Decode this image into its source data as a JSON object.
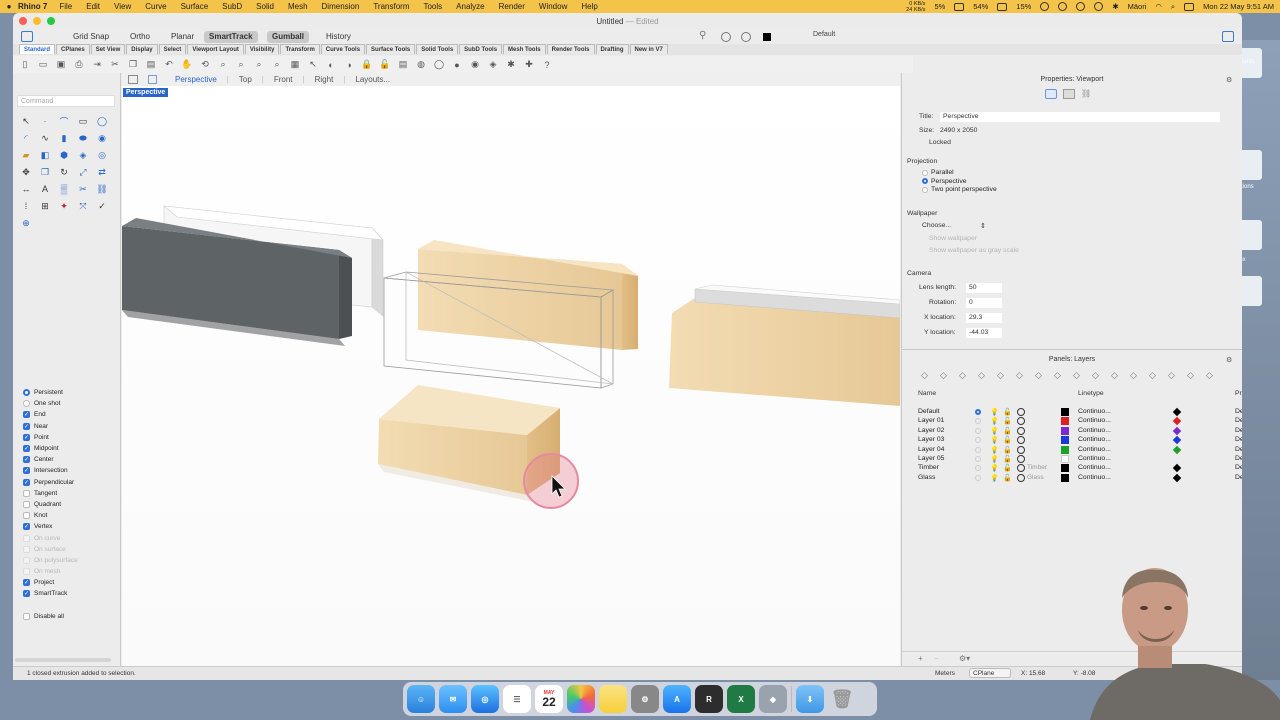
{
  "menubar": {
    "app_name": "Rhino 7",
    "items": [
      "File",
      "Edit",
      "View",
      "Curve",
      "Surface",
      "SubD",
      "Solid",
      "Mesh",
      "Dimension",
      "Transform",
      "Tools",
      "Analyze",
      "Render",
      "Window",
      "Help"
    ],
    "net_up": "0 KB/s",
    "net_down": "24 KB/s",
    "stat1": "5%",
    "stat2": "54%",
    "stat3": "15%",
    "user": "Māori",
    "clock": "Mon 22 May  9:51 AM"
  },
  "window": {
    "title": "Untitled",
    "edited": "— Edited"
  },
  "topbar": {
    "osnap_buttons": [
      "Grid Snap",
      "Ortho",
      "Planar",
      "SmartTrack",
      "Gumball",
      "History"
    ],
    "active_buttons": [
      "SmartTrack",
      "Gumball"
    ],
    "current_layer": "Default"
  },
  "tool_tabs": [
    "Standard",
    "CPlanes",
    "Set View",
    "Display",
    "Select",
    "Viewport Layout",
    "Visibility",
    "Transform",
    "Curve Tools",
    "Surface Tools",
    "Solid Tools",
    "SubD Tools",
    "Mesh Tools",
    "Render Tools",
    "Drafting",
    "New in V7"
  ],
  "active_tool_tab": "Standard",
  "command": {
    "placeholder": "Command"
  },
  "viewport_tabs": {
    "items": [
      "Perspective",
      "Top",
      "Front",
      "Right",
      "Layouts..."
    ],
    "active": "Perspective",
    "label": "Perspective"
  },
  "osnaps": [
    {
      "label": "Persistent",
      "kind": "radio",
      "on": true
    },
    {
      "label": "One shot",
      "kind": "radio",
      "on": false
    },
    {
      "label": "End",
      "kind": "check",
      "on": true
    },
    {
      "label": "Near",
      "kind": "check",
      "on": true
    },
    {
      "label": "Point",
      "kind": "check",
      "on": true
    },
    {
      "label": "Midpoint",
      "kind": "check",
      "on": true
    },
    {
      "label": "Center",
      "kind": "check",
      "on": true
    },
    {
      "label": "Intersection",
      "kind": "check",
      "on": true
    },
    {
      "label": "Perpendicular",
      "kind": "check",
      "on": true
    },
    {
      "label": "Tangent",
      "kind": "check",
      "on": false
    },
    {
      "label": "Quadrant",
      "kind": "check",
      "on": false
    },
    {
      "label": "Knot",
      "kind": "check",
      "on": false
    },
    {
      "label": "Vertex",
      "kind": "check",
      "on": true
    },
    {
      "label": "On curve",
      "kind": "check",
      "on": false,
      "disabled": true
    },
    {
      "label": "On surface",
      "kind": "check",
      "on": false,
      "disabled": true
    },
    {
      "label": "On polysurface",
      "kind": "check",
      "on": false,
      "disabled": true
    },
    {
      "label": "On mesh",
      "kind": "check",
      "on": false,
      "disabled": true
    },
    {
      "label": "Project",
      "kind": "check",
      "on": true
    },
    {
      "label": "SmartTrack",
      "kind": "check",
      "on": true
    },
    {
      "label": "",
      "kind": "spacer"
    },
    {
      "label": "Disable all",
      "kind": "check",
      "on": false
    }
  ],
  "properties": {
    "header": "Properties: Viewport",
    "title_label": "Title:",
    "title_value": "Perspective",
    "size_label": "Size:",
    "size_value": "2490 x 2050",
    "locked_label": "Locked",
    "projection_label": "Projection",
    "projection_options": [
      "Parallel",
      "Perspective",
      "Two point perspective"
    ],
    "projection_selected": "Perspective",
    "wallpaper_label": "Wallpaper",
    "wallpaper_choose": "Choose...",
    "show_wallpaper": "Show wallpaper",
    "show_gray": "Show wallpaper as gray scale",
    "camera_label": "Camera",
    "lens_label": "Lens length:",
    "lens_value": "50",
    "rotation_label": "Rotation:",
    "rotation_value": "0",
    "xloc_label": "X location:",
    "xloc_value": "29.3",
    "yloc_label": "Y location:",
    "yloc_value": "-44.03"
  },
  "layers": {
    "header": "Panels: Layers",
    "col_name": "Name",
    "col_linetype": "Linetype",
    "col_print": "Pr",
    "rows": [
      {
        "name": "Default",
        "current": true,
        "material": "",
        "color": "#000000",
        "linetype": "Continuo...",
        "print_color": "#000000",
        "print": "De"
      },
      {
        "name": "Layer 01",
        "current": false,
        "material": "",
        "color": "#e02020",
        "linetype": "Continuo...",
        "print_color": "#e02020",
        "print": "De"
      },
      {
        "name": "Layer 02",
        "current": false,
        "material": "",
        "color": "#7a2ad0",
        "linetype": "Continuo...",
        "print_color": "#7a2ad0",
        "print": "De"
      },
      {
        "name": "Layer 03",
        "current": false,
        "material": "",
        "color": "#1c3ad8",
        "linetype": "Continuo...",
        "print_color": "#1c3ad8",
        "print": "De"
      },
      {
        "name": "Layer 04",
        "current": false,
        "material": "",
        "color": "#1da12a",
        "linetype": "Continuo...",
        "print_color": "#1da12a",
        "print": "De"
      },
      {
        "name": "Layer 05",
        "current": false,
        "material": "",
        "color": "#ffffff",
        "linetype": "Continuo...",
        "print_color": "",
        "print": "De"
      },
      {
        "name": "Timber",
        "current": false,
        "material": "Timber",
        "color": "#000000",
        "linetype": "Continuo...",
        "print_color": "#000000",
        "print": "De"
      },
      {
        "name": "Glass",
        "current": false,
        "material": "Glass",
        "color": "#000000",
        "linetype": "Continuo...",
        "print_color": "#000000",
        "print": "De"
      }
    ]
  },
  "status": {
    "message": "1 closed extrusion added to selection.",
    "units": "Meters",
    "cplane": "CPlane",
    "x": "X: 15.68",
    "y": "Y: -8.08"
  },
  "dock": {
    "calendar_month": "MAY",
    "calendar_day": "22",
    "apps": [
      "finder-icon",
      "mail-icon",
      "safari-icon",
      "reminders-icon",
      "photos-icon",
      "notes-icon",
      "system-settings-icon",
      "app-store-icon",
      "rhino-icon",
      "excel-icon",
      "other-icon",
      "downloads-icon",
      "trash-icon"
    ]
  },
  "desktop": {
    "label1": "cuments",
    "label2": "lications",
    "label3": "icity",
    "label4": "t.xlsx"
  },
  "colors": {
    "accent": "#2a66c8",
    "menubar": "#f3c34a",
    "timber": "#efd6aa",
    "dark_box": "#5f6467"
  }
}
